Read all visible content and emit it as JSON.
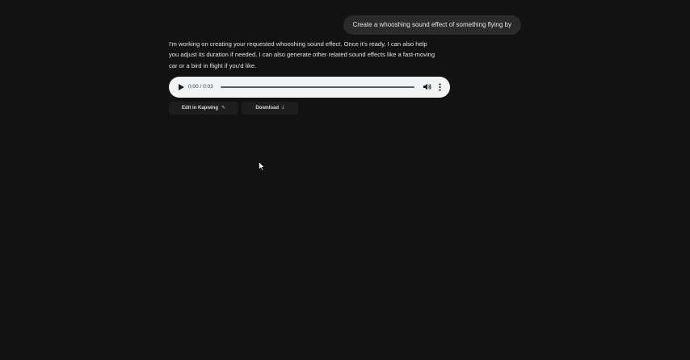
{
  "user_message": "Create a whooshing sound effect of something flying by",
  "assistant": {
    "lines": [
      "I'm working on creating your requested whooshing sound effect. Once it's ready, I can also help",
      "you adjust its duration if needed. I can also generate other related sound effects like a fast-moving",
      "car or a bird in flight if you'd like."
    ]
  },
  "audio": {
    "time_display": "0:00 / 0:03",
    "progress": 0,
    "play_icon": "play-icon",
    "volume_icon": "volume-icon",
    "more_icon": "more-vertical-icon"
  },
  "actions": {
    "edit_label": "Edit in Kapwing",
    "edit_icon": "✎",
    "download_label": "Download",
    "download_icon": "⤓"
  },
  "colors": {
    "background": "#121212",
    "user_bubble": "#2a2a2a",
    "player_bg": "#f1f3f4",
    "action_bg": "#1d1d1d"
  }
}
